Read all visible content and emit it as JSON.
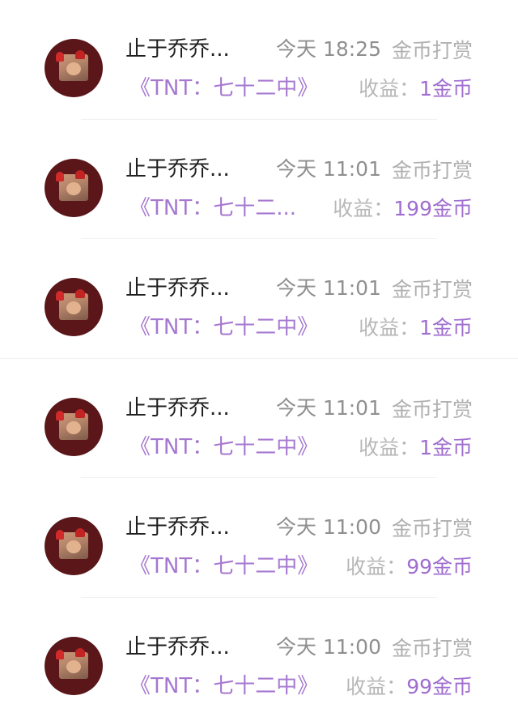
{
  "rows": [
    {
      "name": "止于乔乔...",
      "time": "今天 18:25",
      "type": "金币打赏",
      "book": "《TNT：七十二中》",
      "earn_label": "收益：",
      "earn_value": "1金币"
    },
    {
      "name": "止于乔乔...",
      "time": "今天 11:01",
      "type": "金币打赏",
      "book": "《TNT：七十二...",
      "earn_label": "收益：",
      "earn_value": "199金币"
    },
    {
      "name": "止于乔乔...",
      "time": "今天 11:01",
      "type": "金币打赏",
      "book": "《TNT：七十二中》",
      "earn_label": "收益：",
      "earn_value": "1金币"
    },
    {
      "name": "止于乔乔...",
      "time": "今天 11:01",
      "type": "金币打赏",
      "book": "《TNT：七十二中》",
      "earn_label": "收益：",
      "earn_value": "1金币"
    },
    {
      "name": "止于乔乔...",
      "time": "今天 11:00",
      "type": "金币打赏",
      "book": "《TNT：七十二中》",
      "earn_label": "收益：",
      "earn_value": "99金币"
    },
    {
      "name": "止于乔乔...",
      "time": "今天 11:00",
      "type": "金币打赏",
      "book": "《TNT：七十二中》",
      "earn_label": "收益：",
      "earn_value": "99金币"
    }
  ],
  "colors": {
    "accent": "#a678d0",
    "avatar_bg": "#5a1619",
    "muted": "#b0b0b0"
  }
}
